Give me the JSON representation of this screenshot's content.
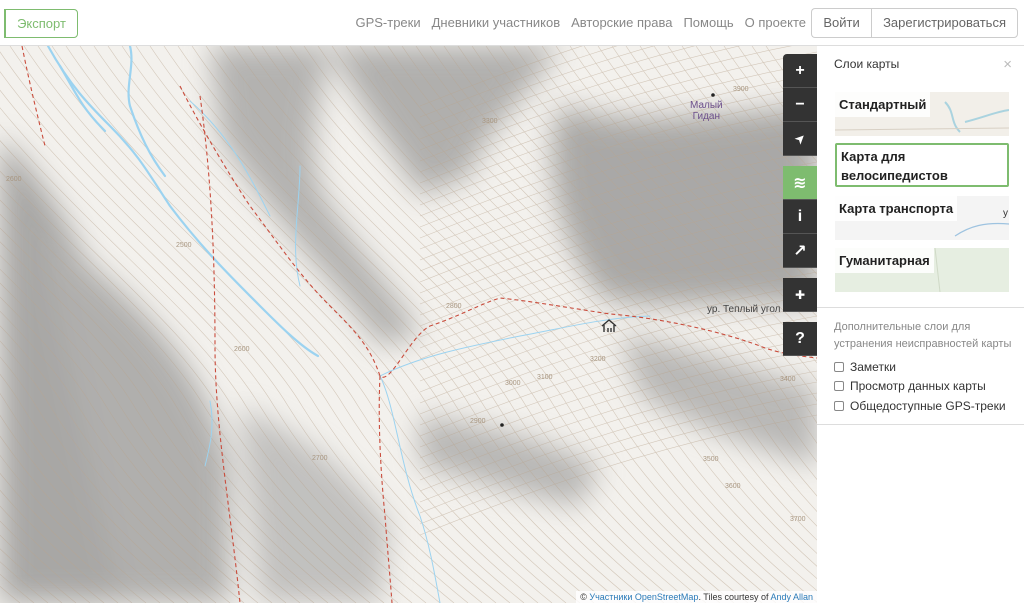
{
  "header": {
    "export_label": "Экспорт",
    "nav": [
      "GPS-треки",
      "Дневники участников",
      "Авторские права",
      "Помощь",
      "О проекте"
    ],
    "login_label": "Войти",
    "signup_label": "Зарегистрироваться"
  },
  "map": {
    "peak_label": "Малый\nГидан",
    "place_label": "ур. Теплый угол",
    "contour_labels": [
      "2600",
      "2500",
      "2600",
      "2700",
      "2800",
      "2900",
      "3000",
      "3100",
      "3200",
      "3300",
      "3400",
      "3500",
      "3600",
      "3700",
      "3900"
    ],
    "attribution": {
      "prefix": "© ",
      "contributors": "Участники",
      "osm": "OpenStreetMap",
      "tiles": ". Tiles courtesy of ",
      "author": "Andy Allan"
    }
  },
  "controls": {
    "zoom_in": "+",
    "zoom_out": "−",
    "locate": "➤",
    "layers": "≋",
    "info": "i",
    "share": "↗",
    "note": "✚",
    "query": "?"
  },
  "sidebar": {
    "title": "Слои карты",
    "close": "×",
    "layers": [
      {
        "label": "Стандартный"
      },
      {
        "label": "Карта для велосипедистов"
      },
      {
        "label": "Карта транспорта"
      },
      {
        "label": "Гуманитарная"
      }
    ],
    "overlay_hint": "Дополнительные слои для устранения неисправностей карты",
    "overlays": [
      "Заметки",
      "Просмотр данных карты",
      "Общедоступные GPS-треки"
    ]
  },
  "colors": {
    "accent": "#7ebc6f",
    "control_bg": "#333333",
    "water": "#9cd3f0",
    "trail": "#c94c3c"
  }
}
